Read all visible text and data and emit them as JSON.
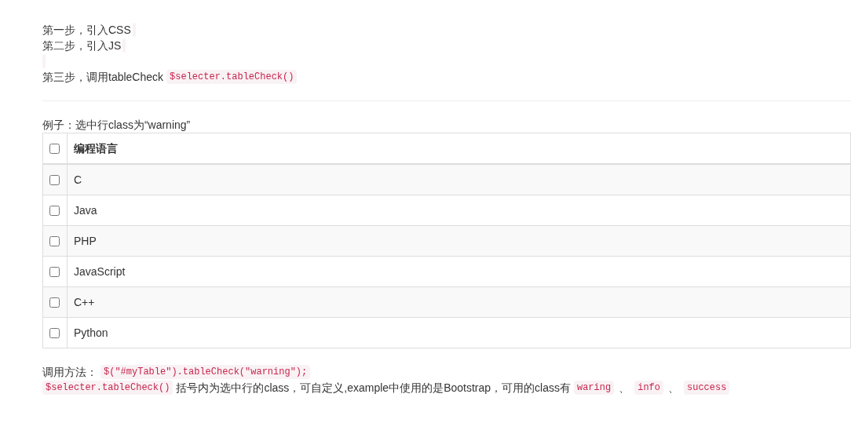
{
  "steps": [
    {
      "text": "第一步，引入CSS",
      "empty_code": true
    },
    {
      "text": "第二步，引入JS",
      "empty_code": true
    },
    {
      "empty_code": true
    },
    {
      "text": "第三步，调用tableCheck",
      "code": "$selecter.tableCheck()",
      "empty_code": false
    }
  ],
  "example_caption": "例子：选中行class为“warning”",
  "table": {
    "header": {
      "label": "编程语言",
      "checked": false
    },
    "rows": [
      {
        "label": "C",
        "checked": false
      },
      {
        "label": "Java",
        "checked": false
      },
      {
        "label": "PHP",
        "checked": false
      },
      {
        "label": "JavaScript",
        "checked": false
      },
      {
        "label": "C++",
        "checked": false
      },
      {
        "label": "Python",
        "checked": false
      }
    ]
  },
  "usage": {
    "label": "调用方法：",
    "code": "$(\"#myTable\").tableCheck(\"warning\");"
  },
  "note": {
    "code": "$selecter.tableCheck()",
    "text": "括号内为选中行的class，可自定义,example中使用的是Bootstrap，可用的class有",
    "classes": [
      "waring",
      "info",
      "success"
    ],
    "separator": "、"
  }
}
